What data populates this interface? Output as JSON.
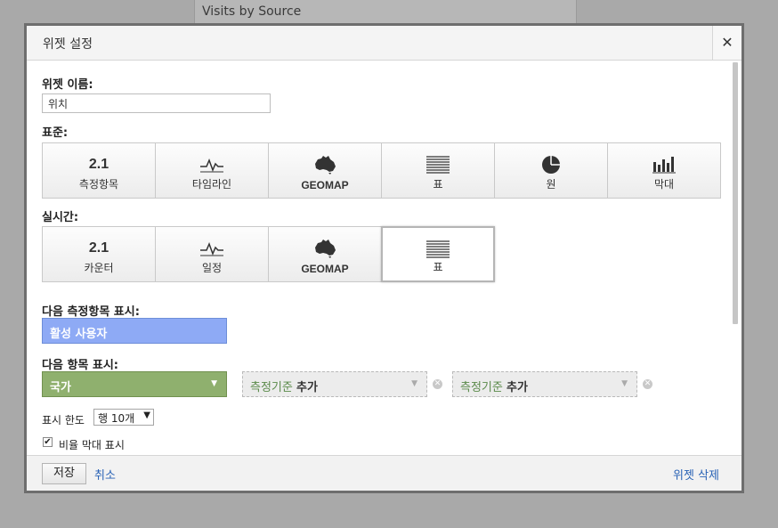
{
  "background": {
    "panel_title": "Visits by Source"
  },
  "dialog": {
    "title": "위젯 설정",
    "close_symbol": "✕",
    "widget_name_label": "위젯 이름:",
    "widget_name_value": "위치",
    "standard_label": "표준:",
    "standard_tiles": [
      {
        "icon": "number-icon",
        "num": "2.1",
        "label": "측정항목"
      },
      {
        "icon": "timeline-icon",
        "label": "타임라인"
      },
      {
        "icon": "geomap-icon",
        "label": "GEOMAP"
      },
      {
        "icon": "table-icon",
        "label": "표"
      },
      {
        "icon": "pie-icon",
        "label": "원"
      },
      {
        "icon": "bar-icon",
        "label": "막대"
      }
    ],
    "realtime_label": "실시간:",
    "realtime_tiles": [
      {
        "icon": "number-icon",
        "num": "2.1",
        "label": "카운터"
      },
      {
        "icon": "timeline-icon",
        "label": "일정"
      },
      {
        "icon": "geomap-icon",
        "label": "GEOMAP"
      },
      {
        "icon": "table-icon",
        "label": "표",
        "selected": true
      }
    ],
    "metric_label": "다음 측정항목 표시:",
    "metric_value": "활성 사용자",
    "dimension_label": "다음 항목 표시:",
    "dimension_primary": "국가",
    "dimension_secondary_prefix": "측정기준",
    "dimension_secondary_action": "추가",
    "limit_label": "표시 한도",
    "limit_value": "행 10개",
    "ratio_bar_label": "비율 막대 표시",
    "ratio_bar_checked": true,
    "save_label": "저장",
    "cancel_label": "취소",
    "delete_label": "위젯 삭제"
  },
  "colors": {
    "metric": "#8eaaf5",
    "dimension": "#8fb06e",
    "link": "#2a63b6"
  }
}
